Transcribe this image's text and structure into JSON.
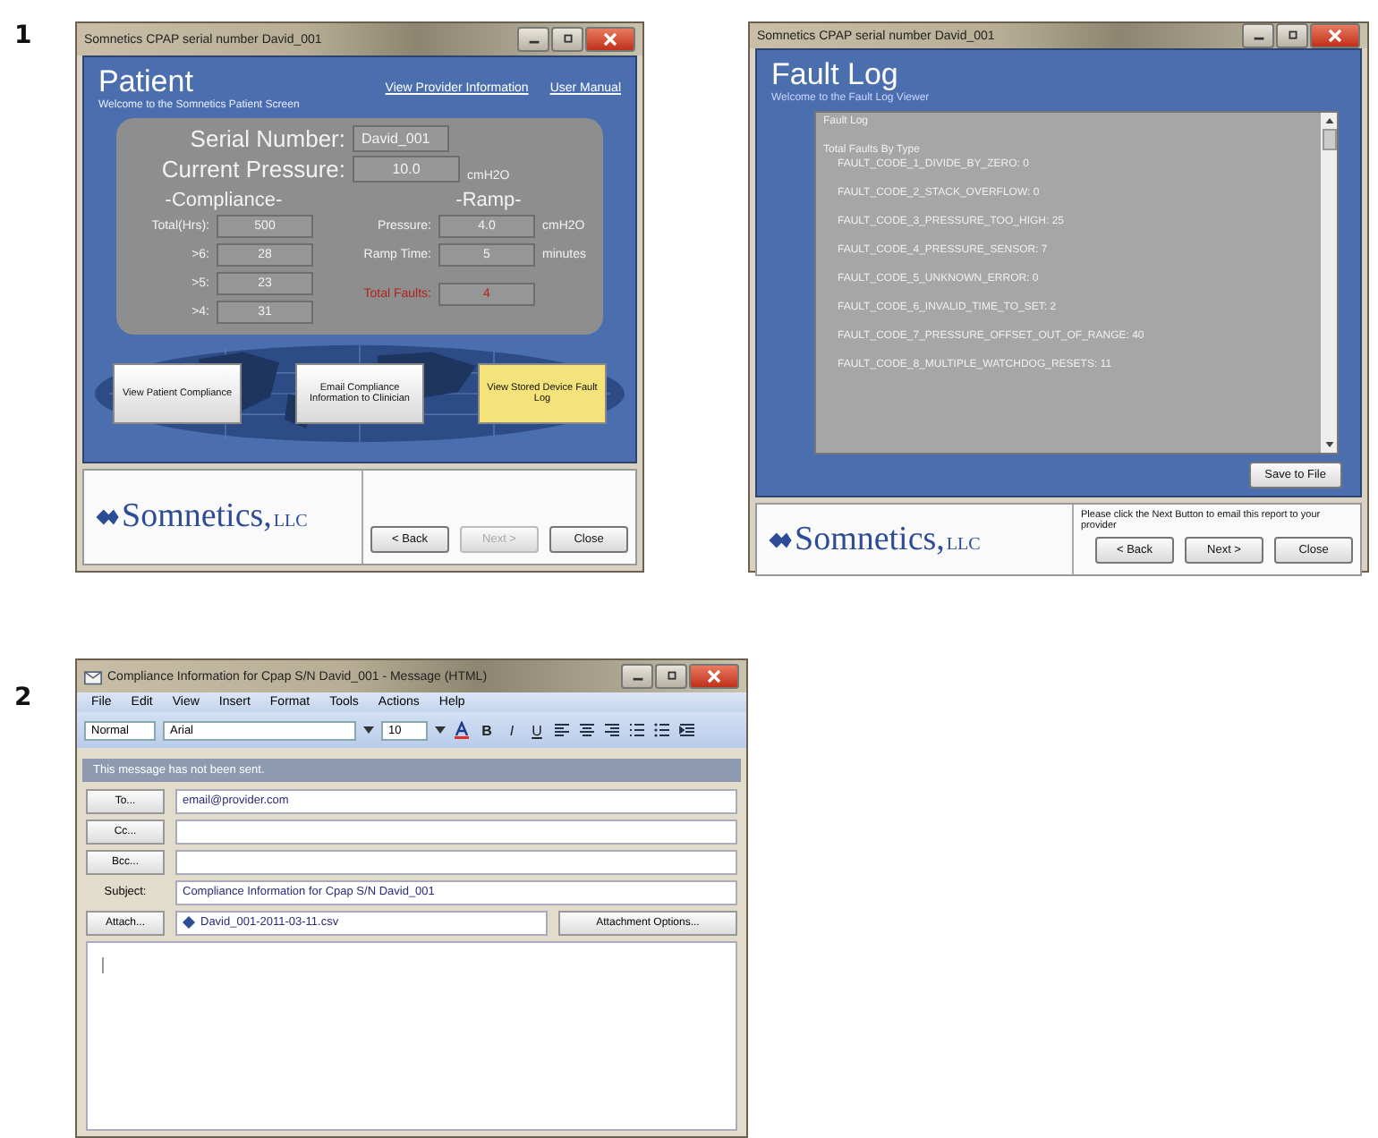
{
  "figure_labels": [
    "1",
    "2"
  ],
  "patient_window": {
    "title": "Somnetics CPAP serial number David_001",
    "heading": "Patient",
    "links": [
      "View Provider Information",
      "User Manual"
    ],
    "subtitle": "Welcome to the Somnetics Patient Screen",
    "serial": {
      "label": "Serial Number:",
      "value": "David_001"
    },
    "pressure": {
      "label": "Current Pressure:",
      "value": "10.0",
      "unit": "cmH2O"
    },
    "compliance": {
      "title": "-Compliance-",
      "rows": [
        {
          "label": "Total(Hrs):",
          "value": "500"
        },
        {
          "label": ">6:",
          "value": "28"
        },
        {
          "label": ">5:",
          "value": "23"
        },
        {
          "label": ">4:",
          "value": "31"
        }
      ]
    },
    "ramp": {
      "title": "-Ramp-",
      "rows": [
        {
          "label": "Pressure:",
          "value": "4.0",
          "unit": "cmH2O"
        },
        {
          "label": "Ramp Time:",
          "value": "5",
          "unit": "minutes"
        }
      ]
    },
    "faults": {
      "label": "Total Faults:",
      "value": "4"
    },
    "actions": [
      {
        "label": "View Patient Compliance",
        "selected": false
      },
      {
        "label": "Email Compliance Information to Clinician",
        "selected": false
      },
      {
        "label": "View Stored Device Fault Log",
        "selected": true
      }
    ],
    "logo": {
      "name": "Somnetics,",
      "suffix": "LLC"
    },
    "nav_buttons": [
      {
        "label": "< Back",
        "disabled": false
      },
      {
        "label": "Next >",
        "disabled": true
      },
      {
        "label": "Close",
        "disabled": false
      }
    ]
  },
  "fault_window": {
    "title": "Somnetics CPAP serial number David_001",
    "heading": "Fault Log",
    "subtitle": "Welcome to the Fault Log Viewer",
    "log_title": "Fault Log",
    "group_title": "Total Faults By Type",
    "entries": [
      "FAULT_CODE_1_DIVIDE_BY_ZERO: 0",
      "FAULT_CODE_2_STACK_OVERFLOW: 0",
      "FAULT_CODE_3_PRESSURE_TOO_HIGH: 25",
      "FAULT_CODE_4_PRESSURE_SENSOR: 7",
      "FAULT_CODE_5_UNKNOWN_ERROR: 0",
      "FAULT_CODE_6_INVALID_TIME_TO_SET: 2",
      "FAULT_CODE_7_PRESSURE_OFFSET_OUT_OF_RANGE: 40",
      "FAULT_CODE_8_MULTIPLE_WATCHDOG_RESETS: 11"
    ],
    "save_button": "Save to File",
    "note": "Please click the Next Button to email this report to your provider",
    "logo": {
      "name": "Somnetics,",
      "suffix": "LLC"
    },
    "nav_buttons": [
      {
        "label": "< Back",
        "disabled": false
      },
      {
        "label": "Next >",
        "disabled": false
      },
      {
        "label": "Close",
        "disabled": false
      }
    ]
  },
  "email_window": {
    "title": "Compliance Information for Cpap S/N David_001 - Message (HTML)",
    "menu": [
      "File",
      "Edit",
      "View",
      "Insert",
      "Format",
      "Tools",
      "Actions",
      "Help"
    ],
    "style": "Normal",
    "font": "Arial",
    "size": "10",
    "format_buttons": [
      "B",
      "I",
      "U"
    ],
    "info_bar": "This message has not been sent.",
    "address_rows": [
      {
        "button": "To...",
        "value": "email@provider.com"
      },
      {
        "button": "Cc..."
      },
      {
        "button": "Bcc..."
      }
    ],
    "subject": {
      "label": "Subject:",
      "value": "Compliance Information for Cpap S/N David_001"
    },
    "attach": {
      "button": "Attach...",
      "file": "David_001-2011-03-11.csv",
      "options": "Attachment Options..."
    }
  }
}
